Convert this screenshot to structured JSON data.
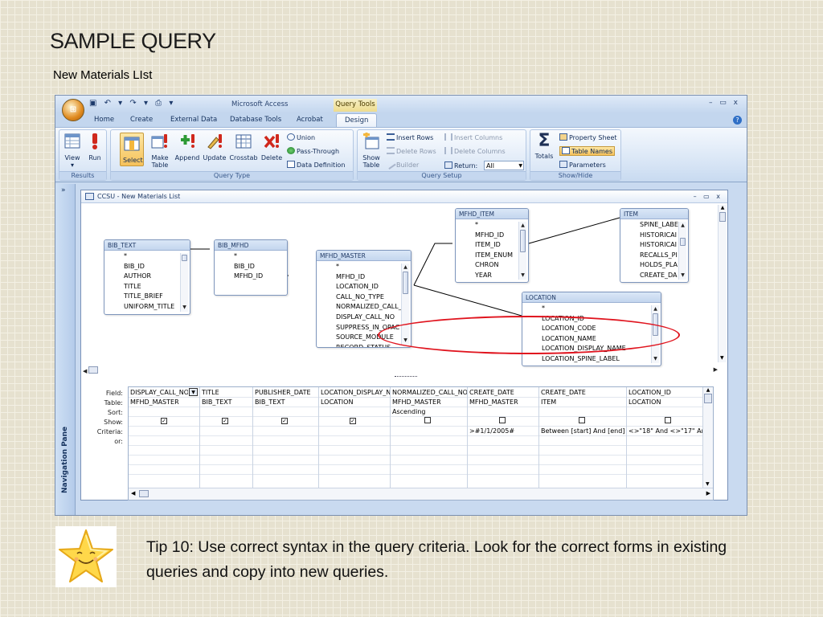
{
  "slide": {
    "title": "SAMPLE QUERY",
    "subtitle": "New Materials LIst",
    "tip": "Tip 10:  Use correct syntax in the query criteria.  Look for the correct forms in existing queries and copy into new queries."
  },
  "app": {
    "title": "Microsoft Access",
    "context_tab": "Query Tools",
    "window_controls": "– ▭ x"
  },
  "tabs": [
    {
      "label": "Home"
    },
    {
      "label": "Create"
    },
    {
      "label": "External Data"
    },
    {
      "label": "Database Tools"
    },
    {
      "label": "Acrobat"
    },
    {
      "label": "Design",
      "active": true
    }
  ],
  "ribbon": {
    "results": {
      "label": "Results",
      "view": "View",
      "run": "Run"
    },
    "query_type": {
      "label": "Query Type",
      "select": "Select",
      "make_table": "Make Table",
      "append": "Append",
      "update": "Update",
      "crosstab": "Crosstab",
      "delete": "Delete",
      "union": "Union",
      "pass_through": "Pass-Through",
      "data_definition": "Data Definition"
    },
    "query_setup": {
      "label": "Query Setup",
      "show_table": "Show Table",
      "insert_rows": "Insert Rows",
      "delete_rows": "Delete Rows",
      "builder": "Builder",
      "insert_columns": "Insert Columns",
      "delete_columns": "Delete Columns",
      "return_label": "Return:",
      "return_value": "All"
    },
    "show_hide": {
      "label": "Show/Hide",
      "totals": "Totals",
      "property_sheet": "Property Sheet",
      "table_names": "Table Names",
      "parameters": "Parameters"
    }
  },
  "nav_pane": {
    "label": "Navigation Pane",
    "chevron": "»"
  },
  "document": {
    "title": "CCSU - New Materials List",
    "controls": "– ▭ x"
  },
  "tables": {
    "bib_text": {
      "name": "BIB_TEXT",
      "fields": [
        "*",
        "BIB_ID",
        "AUTHOR",
        "TITLE",
        "TITLE_BRIEF",
        "UNIFORM_TITLE"
      ]
    },
    "bib_mfhd": {
      "name": "BIB_MFHD",
      "fields": [
        "*",
        "BIB_ID",
        "MFHD_ID"
      ]
    },
    "mfhd_master": {
      "name": "MFHD_MASTER",
      "fields": [
        "*",
        "MFHD_ID",
        "LOCATION_ID",
        "CALL_NO_TYPE",
        "NORMALIZED_CALL_",
        "DISPLAY_CALL_NO",
        "SUPPRESS_IN_OPAC",
        "SOURCE_MODULE",
        "RECORD_STATUS"
      ]
    },
    "mfhd_item": {
      "name": "MFHD_ITEM",
      "fields": [
        "*",
        "MFHD_ID",
        "ITEM_ID",
        "ITEM_ENUM",
        "CHRON",
        "YEAR"
      ]
    },
    "item": {
      "name": "ITEM",
      "fields": [
        "SPINE_LABE",
        "HISTORICAI",
        "HISTORICAI",
        "RECALLS_PI",
        "HOLDS_PLA",
        "CREATE_DA"
      ]
    },
    "location": {
      "name": "LOCATION",
      "fields": [
        "*",
        "LOCATION_ID",
        "LOCATION_CODE",
        "LOCATION_NAME",
        "LOCATION_DISPLAY_NAME",
        "LOCATION_SPINE_LABEL"
      ]
    }
  },
  "grid": {
    "row_labels": [
      "Field:",
      "Table:",
      "Sort:",
      "Show:",
      "Criteria:",
      "or:"
    ],
    "columns": [
      {
        "field": "DISPLAY_CALL_NO",
        "table": "MFHD_MASTER",
        "sort": "",
        "show": true,
        "criteria": ""
      },
      {
        "field": "TITLE",
        "table": "BIB_TEXT",
        "sort": "",
        "show": true,
        "criteria": ""
      },
      {
        "field": "PUBLISHER_DATE",
        "table": "BIB_TEXT",
        "sort": "",
        "show": true,
        "criteria": ""
      },
      {
        "field": "LOCATION_DISPLAY_N",
        "table": "LOCATION",
        "sort": "",
        "show": true,
        "criteria": ""
      },
      {
        "field": "NORMALIZED_CALL_NO",
        "table": "MFHD_MASTER",
        "sort": "Ascending",
        "show": false,
        "criteria": ""
      },
      {
        "field": "CREATE_DATE",
        "table": "MFHD_MASTER",
        "sort": "",
        "show": false,
        "criteria": ">#1/1/2005#"
      },
      {
        "field": "CREATE_DATE",
        "table": "ITEM",
        "sort": "",
        "show": false,
        "criteria": "Between [start] And [end]"
      },
      {
        "field": "LOCATION_ID",
        "table": "LOCATION",
        "sort": "",
        "show": false,
        "criteria": "<>\"18\" And <>\"17\" And <"
      }
    ]
  },
  "colors": {
    "highlight_oval": "#e0141e",
    "ribbon_selected": "#f6c15a",
    "ribbon_bg": "#d6e4f5"
  }
}
